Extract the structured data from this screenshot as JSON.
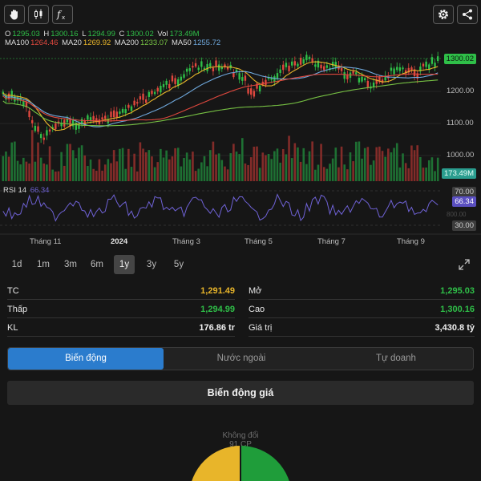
{
  "toolbar": {
    "left_buttons": [
      "hand-icon",
      "candlestick-icon",
      "function-icon"
    ],
    "right_buttons": [
      "gear-icon",
      "share-icon"
    ]
  },
  "ohlc": {
    "o_label": "O",
    "o": "1295.03",
    "h_label": "H",
    "h": "1300.16",
    "l_label": "L",
    "l": "1294.99",
    "c_label": "C",
    "c": "1300.02",
    "vol_label": "Vol",
    "vol": "173.49M"
  },
  "ma": {
    "ma100_label": "MA100",
    "ma100": "1264.46",
    "ma20_label": "MA20",
    "ma20": "1269.92",
    "ma200_label": "MA200",
    "ma200": "1233.07",
    "ma50_label": "MA50",
    "ma50": "1255.72"
  },
  "price_axis": [
    "1200.00",
    "1100.00",
    "1000.00"
  ],
  "last_price_tag": "1300.02",
  "volume_tag": "173.49M",
  "rsi": {
    "label": "RSI 14",
    "value": "66.34",
    "level_high": "70.00",
    "level_low": "30.00",
    "mid_hidden": "800.00"
  },
  "time_axis": [
    "Tháng 11",
    "2024",
    "Tháng 3",
    "Tháng 5",
    "Tháng 7",
    "Tháng 9"
  ],
  "timeframes": [
    "1d",
    "1m",
    "3m",
    "6m",
    "1y",
    "3y",
    "5y"
  ],
  "active_timeframe": "1y",
  "info": {
    "tc_label": "TC",
    "tc_value": "1,291.49",
    "mo_label": "Mở",
    "mo_value": "1,295.03",
    "thap_label": "Thấp",
    "thap_value": "1,294.99",
    "cao_label": "Cao",
    "cao_value": "1,300.16",
    "kl_label": "KL",
    "kl_value": "176.86 tr",
    "giatri_label": "Giá trị",
    "giatri_value": "3,430.8 tỷ"
  },
  "tabs": [
    "Biến động",
    "Nước ngoài",
    "Tự doanh"
  ],
  "active_tab": "Biến động",
  "section_title": "Biến động giá",
  "pie": {
    "unchanged_label": "Không đổi",
    "unchanged_count": "91 CP"
  },
  "colors": {
    "up": "#2fbf48",
    "down": "#e0483e",
    "ref": "#e8b52a",
    "accent": "#2b7ccd",
    "rsi": "#6f62d6",
    "ma100": "#e0483e",
    "ma20": "#e8b52a",
    "ma200": "#76c043",
    "ma50": "#6fa8dc"
  }
}
